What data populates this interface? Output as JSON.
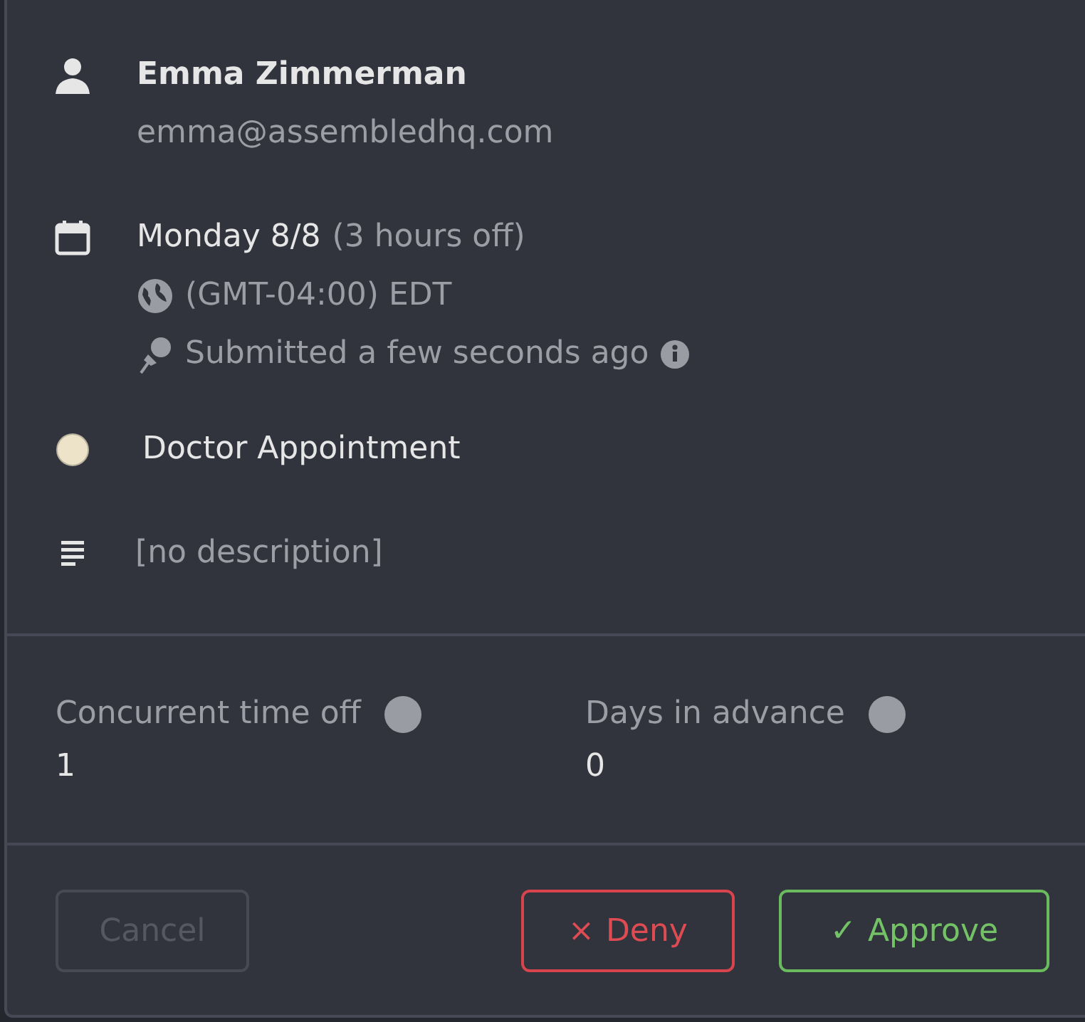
{
  "employee": {
    "name": "Emma Zimmerman",
    "email": "emma@assembledhq.com"
  },
  "schedule": {
    "date": "Monday 8/8",
    "duration": "(3 hours off)",
    "timezone": "(GMT-04:00)  EDT",
    "submitted": "Submitted a few seconds ago"
  },
  "category": {
    "label": "Doctor Appointment",
    "color": "#ede3c8"
  },
  "description": "[no description]",
  "stats": [
    {
      "label": "Concurrent time off",
      "value": "1"
    },
    {
      "label": "Days in advance",
      "value": "0"
    }
  ],
  "buttons": [
    {
      "kind": "cancel",
      "label": "Cancel",
      "disabled": true
    },
    {
      "kind": "deny",
      "glyph": "×",
      "label": "Deny",
      "disabled": false
    },
    {
      "kind": "approve",
      "glyph": "✓",
      "label": "Approve",
      "disabled": false
    }
  ]
}
